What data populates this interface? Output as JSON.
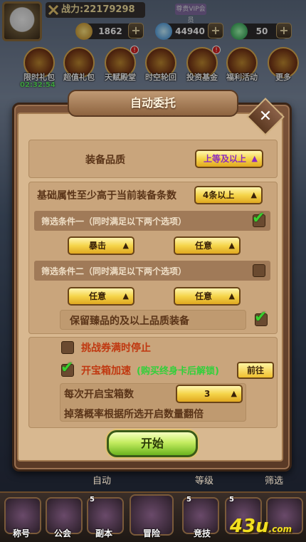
{
  "hud": {
    "power_label": "战力:",
    "power_value": "22179298",
    "vip_label": "尊贵VIP会员",
    "resources": [
      {
        "name": "gold",
        "value": "1862",
        "color": "#d8a840"
      },
      {
        "name": "diamond",
        "value": "44940",
        "color": "#50b0f0"
      },
      {
        "name": "jade",
        "value": "50",
        "color": "#30c060"
      }
    ],
    "events": [
      {
        "label": "限时礼包",
        "badge": ""
      },
      {
        "label": "超值礼包",
        "badge": ""
      },
      {
        "label": "天赋殿堂",
        "badge": "!"
      },
      {
        "label": "时空轮回",
        "badge": ""
      },
      {
        "label": "投资基金",
        "badge": "!"
      },
      {
        "label": "福利活动",
        "badge": ""
      },
      {
        "label": "更多",
        "badge": ""
      }
    ],
    "timer": "02:32:54"
  },
  "dialog": {
    "title": "自动委托",
    "close_symbol": "✕",
    "quality_label": "装备品质",
    "quality_value": "上等及以上",
    "base_attr_label": "基础属性至少高于当前装备条数",
    "base_attr_value": "4条以上",
    "filter1_label": "筛选条件一（同时满足以下两个选项）",
    "filter1_checked": true,
    "filter1_opt_a": "暴击",
    "filter1_opt_b": "任意",
    "filter2_label": "筛选条件二（同时满足以下两个选项）",
    "filter2_checked": false,
    "filter2_opt_a": "任意",
    "filter2_opt_b": "任意",
    "keep_label": "保留臻品的及以上品质装备",
    "keep_checked": true,
    "stop_label": "挑战券满时停止",
    "stop_checked": false,
    "speed_label": "开宝箱加速",
    "speed_hint": "(购买终身卡后解锁)",
    "speed_checked": true,
    "goto_label": "前往",
    "chest_count_label": "每次开启宝箱数",
    "chest_count_value": "3",
    "drop_note": "掉落概率根据所选开启数量翻倍",
    "start_label": "开始",
    "arrow": "▲"
  },
  "behind": {
    "left": "自动",
    "mid": "等级",
    "right": "筛选"
  },
  "nav": [
    {
      "label": "称号",
      "num": ""
    },
    {
      "label": "公会",
      "num": ""
    },
    {
      "label": "副本",
      "num": "5"
    },
    {
      "label": "冒险",
      "num": ""
    },
    {
      "label": "竞技",
      "num": "5"
    },
    {
      "label": "",
      "num": "5"
    },
    {
      "label": "",
      "num": ""
    }
  ],
  "watermark": {
    "main": "43u",
    "suffix": ".com"
  }
}
